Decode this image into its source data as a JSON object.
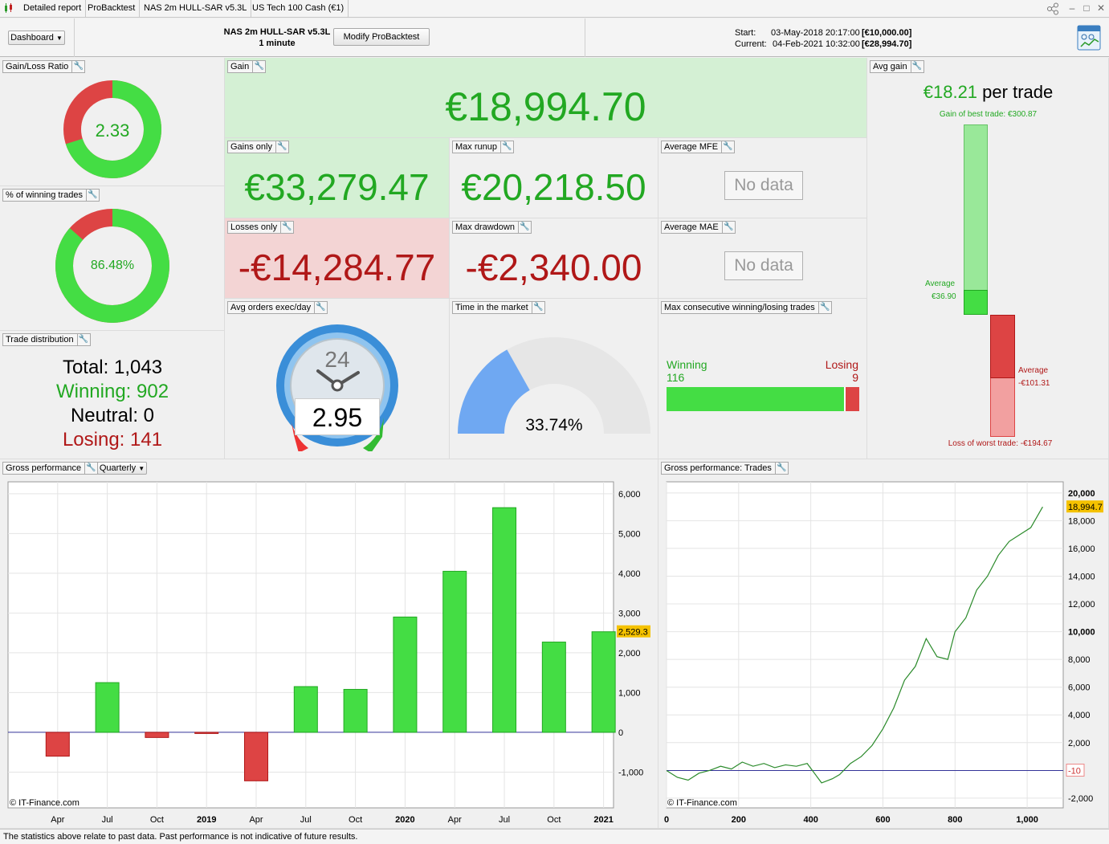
{
  "titlebar": {
    "tabs": [
      "Detailed report",
      "ProBacktest",
      "NAS 2m HULL-SAR v5.3L",
      "US Tech 100 Cash (€1)"
    ]
  },
  "header": {
    "dashboard_label": "Dashboard",
    "strategy_name": "NAS 2m HULL-SAR v5.3L",
    "timeframe": "1 minute",
    "modify_button": "Modify ProBacktest",
    "start_label": "Start:",
    "start_date": "03-May-2018 20:17:00",
    "start_value": "[€10,000.00]",
    "current_label": "Current:",
    "current_date": "04-Feb-2021 10:32:00",
    "current_value": "[€28,994.70]"
  },
  "gain_loss_ratio": {
    "title": "Gain/Loss Ratio",
    "value": "2.33",
    "win_fraction": 0.7
  },
  "winning_trades": {
    "title": "% of winning trades",
    "value": "86.48%",
    "win_fraction": 0.8648
  },
  "trade_distribution": {
    "title": "Trade distribution",
    "total_label": "Total:",
    "total": "1,043",
    "winning_label": "Winning:",
    "winning": "902",
    "neutral_label": "Neutral:",
    "neutral": "0",
    "losing_label": "Losing:",
    "losing": "141"
  },
  "gain": {
    "title": "Gain",
    "value": "€18,994.70"
  },
  "gains_only": {
    "title": "Gains only",
    "value": "€33,279.47"
  },
  "losses_only": {
    "title": "Losses only",
    "value": "-€14,284.77"
  },
  "max_runup": {
    "title": "Max runup",
    "value": "€20,218.50"
  },
  "max_drawdown": {
    "title": "Max drawdown",
    "value": "-€2,340.00"
  },
  "average_mfe": {
    "title": "Average MFE",
    "value": "No data"
  },
  "average_mae": {
    "title": "Average MAE",
    "value": "No data"
  },
  "avg_orders": {
    "title": "Avg orders exec/day",
    "value": "2.95",
    "dial_label": "24"
  },
  "time_in_market": {
    "title": "Time in the market",
    "value": "33.74%",
    "fraction": 0.3374
  },
  "consecutive": {
    "title": "Max consecutive winning/losing trades",
    "winning_label": "Winning",
    "winning": "116",
    "losing_label": "Losing",
    "losing": "9"
  },
  "avg_gain": {
    "title": "Avg gain",
    "value": "€18.21",
    "suffix": "per trade",
    "best_label": "Gain of best trade: €300.87",
    "avg_gain_label": "Average",
    "avg_gain_value": "€36.90",
    "avg_loss_label": "Average",
    "avg_loss_value": "-€101.31",
    "worst_label": "Loss of worst trade: -€194.67"
  },
  "gross_perf": {
    "title": "Gross performance",
    "period_label": "Quarterly",
    "copyright": "© IT-Finance.com",
    "last_value_label": "2,529.3"
  },
  "gross_trades": {
    "title": "Gross performance: Trades",
    "copyright": "© IT-Finance.com",
    "last_value_label": "18,994.7",
    "baseline_label": "-10"
  },
  "colors": {
    "green": "#44dd44",
    "red": "#dd4444",
    "gain_bg": "#d4f0d4",
    "loss_bg": "#f3d4d4"
  },
  "footer": {
    "text": "The statistics above relate to past data. Past performance is not indicative of future results."
  },
  "chart_data": [
    {
      "type": "bar",
      "categories": [
        "Apr",
        "Jul",
        "Oct",
        "2019",
        "Apr",
        "Jul",
        "Oct",
        "2020",
        "Apr",
        "Jul",
        "Oct",
        "2021"
      ],
      "values": [
        -600,
        1250,
        -130,
        -30,
        -1220,
        1150,
        1080,
        2900,
        4050,
        5650,
        2270,
        2529.3
      ],
      "ylim": [
        -1900,
        6300
      ],
      "yticks": [
        -1000,
        0,
        1000,
        2000,
        3000,
        4000,
        5000,
        6000
      ],
      "ytick_labels": [
        "-1,000",
        "0",
        "1,000",
        "2,000",
        "3,000",
        "4,000",
        "5,000",
        "6,000"
      ],
      "bold_ticks": [
        "2019",
        "2020",
        "2021"
      ]
    },
    {
      "type": "line",
      "x": [
        0,
        30,
        60,
        90,
        120,
        150,
        180,
        210,
        240,
        270,
        300,
        330,
        360,
        390,
        410,
        430,
        460,
        480,
        510,
        540,
        570,
        600,
        630,
        660,
        690,
        720,
        750,
        780,
        800,
        830,
        860,
        890,
        920,
        950,
        980,
        1010,
        1043
      ],
      "y": [
        -10,
        -500,
        -700,
        -200,
        0,
        300,
        100,
        600,
        300,
        500,
        200,
        400,
        300,
        500,
        -200,
        -900,
        -600,
        -300,
        500,
        1000,
        1800,
        3000,
        4500,
        6500,
        7500,
        9500,
        8200,
        8000,
        10000,
        11000,
        13000,
        14000,
        15500,
        16500,
        17000,
        17500,
        18994.7
      ],
      "xlim": [
        0,
        1100
      ],
      "xticks": [
        0,
        200,
        400,
        600,
        800,
        1000
      ],
      "xtick_labels": [
        "0",
        "200",
        "400",
        "600",
        "800",
        "1,000"
      ],
      "ylim": [
        -2700,
        20800
      ],
      "yticks": [
        -2000,
        0,
        2000,
        4000,
        6000,
        8000,
        10000,
        12000,
        14000,
        16000,
        18000,
        20000
      ],
      "ytick_labels": [
        "-2,000",
        "0",
        "2,000",
        "4,000",
        "6,000",
        "8,000",
        "10,000",
        "12,000",
        "14,000",
        "16,000",
        "18,000",
        "20,000"
      ]
    }
  ]
}
